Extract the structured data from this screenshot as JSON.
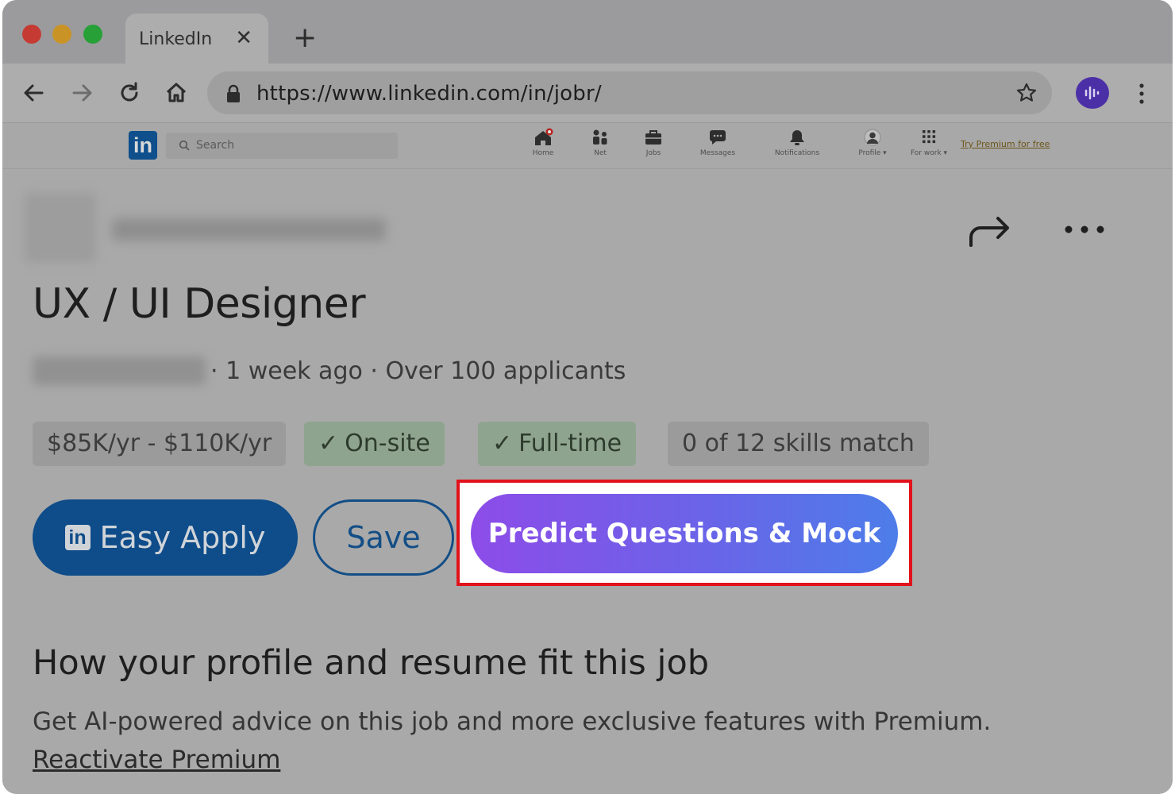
{
  "browser": {
    "tab_title": "LinkedIn",
    "tab_close": "✕",
    "new_tab": "+",
    "url": "https://www.linkedin.com/in/jobr/"
  },
  "linkedin": {
    "logo": "in",
    "search_placeholder": "Search",
    "nav": [
      {
        "label": "Home",
        "icon": "home-icon"
      },
      {
        "label": "Net",
        "icon": "network-icon"
      },
      {
        "label": "Jobs",
        "icon": "briefcase-icon"
      },
      {
        "label": "Messages",
        "icon": "messages-icon"
      },
      {
        "label": "Notifications",
        "icon": "bell-icon"
      },
      {
        "label": "Profile ▾",
        "icon": "avatar"
      },
      {
        "label": "For work ▾",
        "icon": "grid-icon"
      }
    ],
    "premium_link": "Try Premium for free"
  },
  "job": {
    "title": "UX / UI Designer",
    "meta": "· 1 week ago · Over 100 applicants",
    "chips": [
      {
        "label": "$85K/yr - $110K/yr",
        "check": false
      },
      {
        "label": "On-site",
        "check": true
      },
      {
        "label": "Full-time",
        "check": true
      },
      {
        "label": "0 of 12 skills match",
        "check": false
      }
    ],
    "easy_apply_logo": "in",
    "easy_apply": "Easy Apply",
    "save": "Save",
    "predict": "Predict Questions & Mock"
  },
  "fit": {
    "title": "How your profile and resume fit this job",
    "desc": "Get AI-powered advice on this job and more exclusive features with Premium.",
    "link": "Reactivate Premium"
  },
  "colors": {
    "highlight_border": "#e1121c",
    "predict_gradient_start": "#8d4ce8",
    "predict_gradient_end": "#4d7de9",
    "linkedin_blue": "#0e4c8a"
  }
}
